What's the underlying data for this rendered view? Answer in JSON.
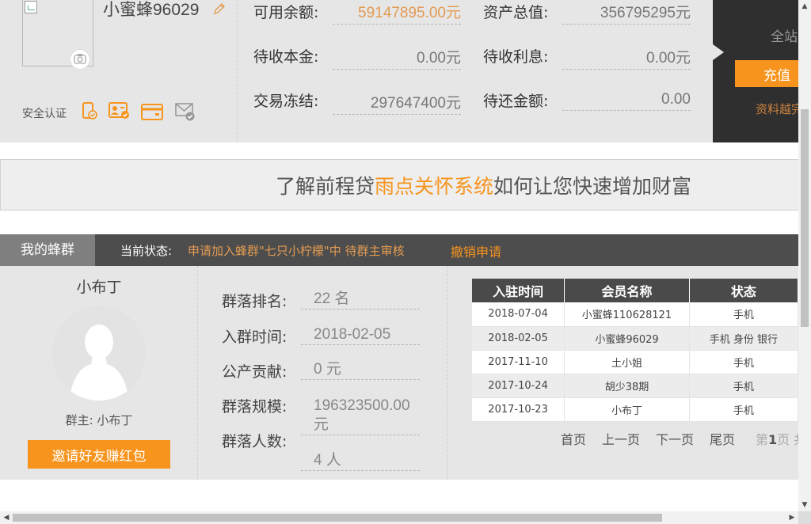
{
  "account": {
    "username": "小蜜蜂96029",
    "security_label": "安全认证",
    "security_icons": [
      "phone-verified-icon",
      "id-card-verified-icon",
      "bank-card-icon",
      "email-verified-icon"
    ],
    "fields": [
      {
        "label": "可用余额:",
        "value": "59147895.00元",
        "accent": true
      },
      {
        "label": "资产总值:",
        "value": "356795295元"
      },
      {
        "label": "待收本金:",
        "value": "0.00元"
      },
      {
        "label": "待收利息:",
        "value": "0.00元"
      },
      {
        "label": "交易冻结:",
        "value": "297647400元"
      },
      {
        "label": "待还金额:",
        "value": "0.00"
      }
    ]
  },
  "side_panel": {
    "title": "全站",
    "recharge_label": "充值",
    "link": "资料越完"
  },
  "banner": {
    "prefix": "了解前程贷",
    "highlight": "雨点关怀系统",
    "suffix": "如何让您快速增加财富"
  },
  "hive": {
    "tab_label": "我的蜂群",
    "status_label": "当前状态:",
    "status_text": "申请加入蜂群\"七只小柠檬\"中   待群主审核",
    "cancel_label": "撤销申请",
    "leader_name": "小布丁",
    "owner_line": "群主: 小布丁",
    "invite_label": "邀请好友赚红包",
    "stats": [
      {
        "label": "群落排名:",
        "value": "22 名"
      },
      {
        "label": "入群时间:",
        "value": "2018-02-05"
      },
      {
        "label": "公产贡献:",
        "value": "0 元"
      },
      {
        "label": "群落规模:",
        "value": "196323500.00元"
      },
      {
        "label": "群落人数:",
        "value": "4 人"
      }
    ],
    "table": {
      "headers": [
        "入驻时间",
        "会员名称",
        "状态"
      ],
      "rows": [
        [
          "2018-07-04",
          "小蜜蜂110628121",
          "手机"
        ],
        [
          "2018-02-05",
          "小蜜蜂96029",
          "手机 身份 银行"
        ],
        [
          "2017-11-10",
          "土小姐",
          "手机"
        ],
        [
          "2017-10-24",
          "胡少38期",
          "手机"
        ],
        [
          "2017-10-23",
          "小布丁",
          "手机"
        ]
      ]
    },
    "pager": {
      "first": "首页",
      "prev": "上一页",
      "next": "下一页",
      "last": "尾页",
      "page_prefix": "第",
      "page_num": "1",
      "page_suffix": "页 共"
    }
  },
  "colors": {
    "accent": "#f7941d",
    "accent_text": "#e39b52",
    "dark_bar": "#4d4d4d",
    "panel_bg": "#e6e6e6"
  }
}
